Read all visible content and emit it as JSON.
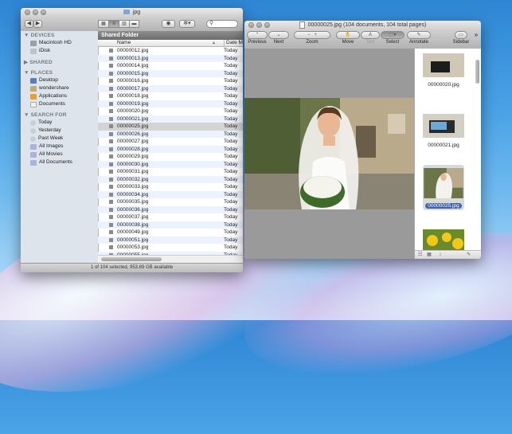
{
  "finder": {
    "title": "jpg",
    "search_placeholder": "",
    "sidebar": {
      "devices_header": "DEVICES",
      "devices": [
        {
          "label": "Macintosh HD",
          "icon": "hard-drive-icon"
        },
        {
          "label": "iDisk",
          "icon": "idisk-icon"
        }
      ],
      "shared_header": "SHARED",
      "places_header": "PLACES",
      "places": [
        {
          "label": "Desktop",
          "icon": "desktop-icon"
        },
        {
          "label": "wondershare",
          "icon": "home-icon"
        },
        {
          "label": "Applications",
          "icon": "applications-icon"
        },
        {
          "label": "Documents",
          "icon": "documents-icon"
        }
      ],
      "search_header": "SEARCH FOR",
      "searches": [
        {
          "label": "Today",
          "icon": "clock-icon"
        },
        {
          "label": "Yesterday",
          "icon": "clock-icon"
        },
        {
          "label": "Past Week",
          "icon": "clock-icon"
        },
        {
          "label": "All Images",
          "icon": "smart-folder-icon"
        },
        {
          "label": "All Movies",
          "icon": "smart-folder-icon"
        },
        {
          "label": "All Documents",
          "icon": "smart-folder-icon"
        }
      ]
    },
    "folder_header": "Shared Folder",
    "col_name": "Name",
    "col_date": "Date M",
    "files": [
      {
        "name": "00000012.jpg",
        "date": "Today"
      },
      {
        "name": "00000013.jpg",
        "date": "Today"
      },
      {
        "name": "00000014.jpg",
        "date": "Today"
      },
      {
        "name": "00000015.jpg",
        "date": "Today"
      },
      {
        "name": "00000016.jpg",
        "date": "Today"
      },
      {
        "name": "00000017.jpg",
        "date": "Today"
      },
      {
        "name": "00000018.jpg",
        "date": "Today"
      },
      {
        "name": "00000019.jpg",
        "date": "Today"
      },
      {
        "name": "00000020.jpg",
        "date": "Today"
      },
      {
        "name": "00000021.jpg",
        "date": "Today"
      },
      {
        "name": "00000025.jpg",
        "date": "Today",
        "selected": true
      },
      {
        "name": "00000026.jpg",
        "date": "Today"
      },
      {
        "name": "00000027.jpg",
        "date": "Today"
      },
      {
        "name": "00000028.jpg",
        "date": "Today"
      },
      {
        "name": "00000029.jpg",
        "date": "Today"
      },
      {
        "name": "00000030.jpg",
        "date": "Today"
      },
      {
        "name": "00000031.jpg",
        "date": "Today"
      },
      {
        "name": "00000032.jpg",
        "date": "Today"
      },
      {
        "name": "00000033.jpg",
        "date": "Today"
      },
      {
        "name": "00000034.jpg",
        "date": "Today"
      },
      {
        "name": "00000035.jpg",
        "date": "Today"
      },
      {
        "name": "00000036.jpg",
        "date": "Today"
      },
      {
        "name": "00000037.jpg",
        "date": "Today"
      },
      {
        "name": "00000038.jpg",
        "date": "Today"
      },
      {
        "name": "00000049.jpg",
        "date": "Today"
      },
      {
        "name": "00000051.jpg",
        "date": "Today"
      },
      {
        "name": "00000053.jpg",
        "date": "Today"
      },
      {
        "name": "00000055.jpg",
        "date": "Today"
      }
    ],
    "status": "1 of 104 selected, 953.89 GB available"
  },
  "preview": {
    "title": "00000025.jpg (104 documents, 104 total pages)",
    "toolbar": {
      "previous": "Previous",
      "next": "Next",
      "zoom": "Zoom",
      "move": "Move",
      "text": "Text",
      "select": "Select",
      "annotate": "Annotate",
      "sidebar": "Sidebar"
    },
    "thumbnails": [
      {
        "label": "00000020.jpg"
      },
      {
        "label": "00000021.jpg"
      },
      {
        "label": "00000025.jpg",
        "selected": true
      }
    ]
  }
}
